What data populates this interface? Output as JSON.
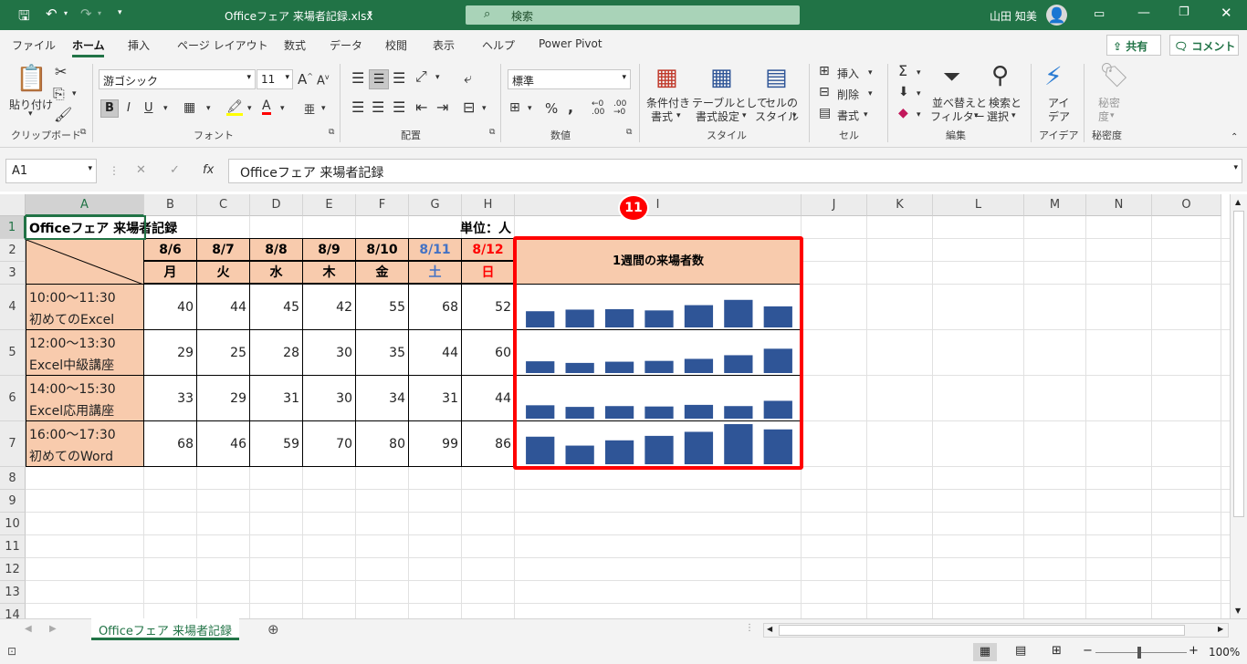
{
  "title": {
    "filename": "Officeフェア 来場者記録.xlsx",
    "dropdown_icon": "chevron-down-icon",
    "search": "検索",
    "user": "山田 知美"
  },
  "menu": [
    "ファイル",
    "ホーム",
    "挿入",
    "ページ レイアウト",
    "数式",
    "データ",
    "校閲",
    "表示",
    "ヘルプ",
    "Power Pivot"
  ],
  "menu_active": "ホーム",
  "share": "共有",
  "comment": "コメント",
  "ribbon": {
    "paste": "貼り付け",
    "font_name": "游ゴシック",
    "font_size": "11",
    "number_format": "標準",
    "cond_format": [
      "条件付き",
      "書式"
    ],
    "table_format": [
      "テーブルとして",
      "書式設定"
    ],
    "cell_style": [
      "セルの",
      "スタイル"
    ],
    "insert": "挿入",
    "delete": "削除",
    "format": "書式",
    "sort_filter": [
      "並べ替えと",
      "フィルター"
    ],
    "find_select": [
      "検索と",
      "選択"
    ],
    "ideas": [
      "アイ",
      "デア"
    ],
    "sensitivity": [
      "秘密",
      "度"
    ],
    "groups": [
      "クリップボード",
      "フォント",
      "配置",
      "数値",
      "スタイル",
      "セル",
      "編集",
      "アイデア",
      "秘密度"
    ]
  },
  "formula_bar": {
    "name_box": "A1",
    "fx": "fx",
    "content": "Officeフェア 来場者記録"
  },
  "columns": [
    "A",
    "B",
    "C",
    "D",
    "E",
    "F",
    "G",
    "H",
    "I",
    "J",
    "K",
    "L",
    "M",
    "N",
    "O"
  ],
  "rows": [
    "1",
    "2",
    "3",
    "4",
    "5",
    "6",
    "7",
    "8",
    "9",
    "10",
    "11",
    "12",
    "13",
    "14"
  ],
  "sheet": {
    "title": "Officeフェア 来場者記録",
    "unit": "単位：人",
    "dates": [
      "8/6",
      "8/7",
      "8/8",
      "8/9",
      "8/10",
      "8/11",
      "8/12"
    ],
    "weekdays": [
      "月",
      "火",
      "水",
      "木",
      "金",
      "土",
      "日"
    ],
    "sessions": [
      {
        "time": "10:00～11:30",
        "name": "初めてのExcel",
        "values": [
          40,
          44,
          45,
          42,
          55,
          68,
          52
        ]
      },
      {
        "time": "12:00～13:30",
        "name": "Excel中級講座",
        "values": [
          29,
          25,
          28,
          30,
          35,
          44,
          60
        ]
      },
      {
        "time": "14:00～15:30",
        "name": "Excel応用講座",
        "values": [
          33,
          29,
          31,
          30,
          34,
          31,
          44
        ]
      },
      {
        "time": "16:00～17:30",
        "name": "初めてのWord",
        "values": [
          68,
          46,
          59,
          70,
          80,
          99,
          86
        ]
      }
    ],
    "sparkline_header": "1週間の来場者数",
    "callout": "11",
    "colors": {
      "saturday": "#4472c4",
      "sunday": "#ff0000",
      "header_fill": "#f8cbad",
      "bar": "#2f5597",
      "highlight": "#ff0000"
    }
  },
  "sheet_tab": "Officeフェア 来場者記録",
  "status": {
    "zoom": "100%"
  }
}
